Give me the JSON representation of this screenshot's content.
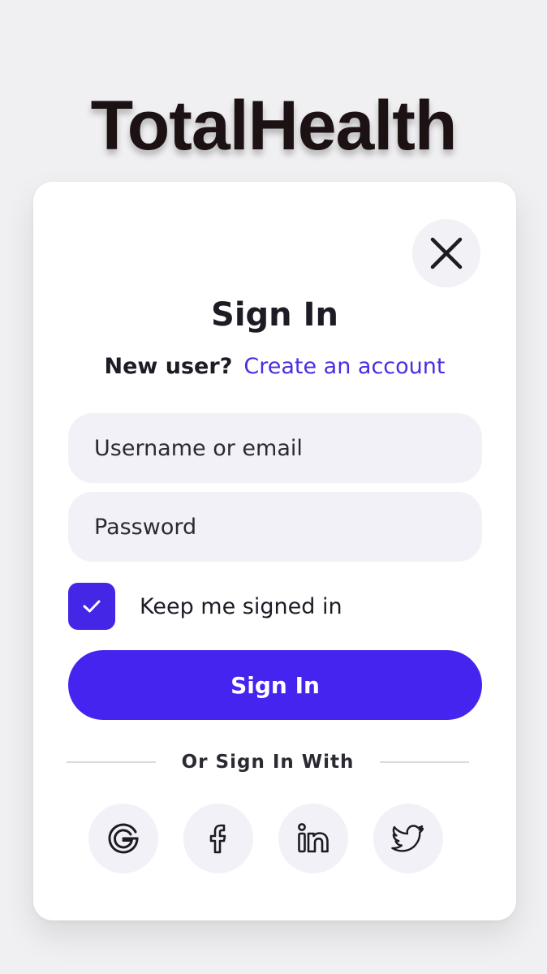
{
  "brand": {
    "name": "TotalHealth"
  },
  "dialog": {
    "title": "Sign In",
    "new_user_prompt": "New user?",
    "create_account_link": "Create an account",
    "username_placeholder": "Username or email",
    "password_placeholder": "Password",
    "keep_signed_in_label": "Keep me signed in",
    "keep_signed_in_checked": true,
    "sign_in_button": "Sign In",
    "divider_text": "Or Sign In With",
    "close_icon": "close-icon",
    "social_providers": [
      {
        "name": "google",
        "icon": "google-icon"
      },
      {
        "name": "facebook",
        "icon": "facebook-icon"
      },
      {
        "name": "linkedin",
        "icon": "linkedin-icon"
      },
      {
        "name": "twitter",
        "icon": "twitter-icon"
      }
    ]
  },
  "colors": {
    "accent": "#4624f0",
    "link": "#4a2fe0",
    "background": "#f0f0f2",
    "field_background": "#f1f1f7"
  }
}
